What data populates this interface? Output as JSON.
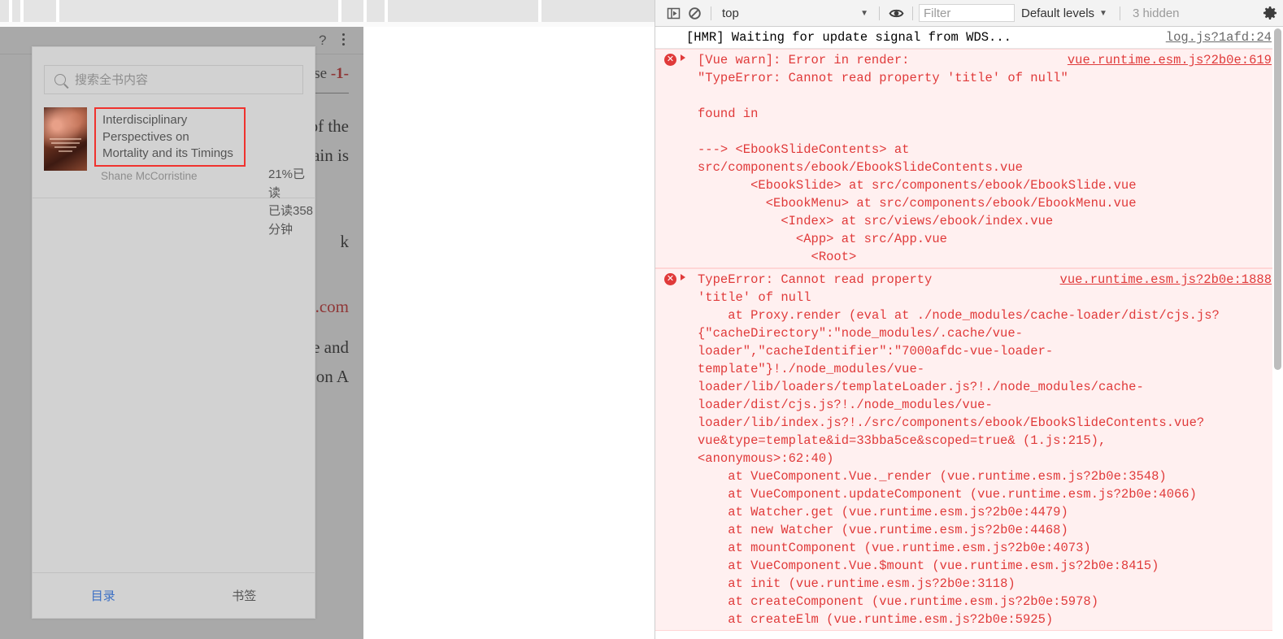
{
  "browser": {
    "skeleton_separators_x": [
      11,
      25,
      69,
      416,
      447,
      473,
      662
    ]
  },
  "reader": {
    "toolbar": {
      "question_icon": "question-mark-icon",
      "menu_icon": "more-vertical-icon"
    },
    "page_text": {
      "running_head": "Corpse",
      "page_number": "-1-",
      "paragraphs": [
        "ed until the morning, when the fall of the curtain is",
        "k",
        "www.example.com",
        "The body was surrounded by of the wake and the sick. upon A"
      ]
    },
    "panel": {
      "search": {
        "placeholder": "搜索全书内容",
        "value": "",
        "icon": "search-icon"
      },
      "book": {
        "title": "Interdisciplinary Perspectives on Mortality and its Timings",
        "author": "Shane McCorristine",
        "progress_percent": "21%已读",
        "progress_time": "已读358分钟",
        "cover_alt": "book-cover"
      },
      "tabs": [
        {
          "label": "目录",
          "active": true
        },
        {
          "label": "书签",
          "active": false
        }
      ]
    }
  },
  "devtools": {
    "toolbar": {
      "sidebar_toggle_icon": "console-sidebar-icon",
      "clear_icon": "clear-console-icon",
      "context": "top",
      "context_caret": "▼",
      "eye_icon": "live-expression-eye-icon",
      "filter_placeholder": "Filter",
      "filter_value": "",
      "levels_label": "Default levels",
      "levels_caret": "▼",
      "hidden_label": "3 hidden",
      "settings_icon": "gear-icon"
    },
    "messages": [
      {
        "type": "info",
        "text": "[HMR] Waiting for update signal from WDS...",
        "source": "log.js?1afd:24"
      },
      {
        "type": "error",
        "expandable": true,
        "text": "[Vue warn]: Error in render:\n\"TypeError: Cannot read property 'title' of null\"\n\nfound in\n\n---> <EbookSlideContents> at\nsrc/components/ebook/EbookSlideContents.vue\n       <EbookSlide> at src/components/ebook/EbookSlide.vue\n         <EbookMenu> at src/components/ebook/EbookMenu.vue\n           <Index> at src/views/ebook/index.vue\n             <App> at src/App.vue\n               <Root>",
        "source": "vue.runtime.esm.js?2b0e:619"
      },
      {
        "type": "error",
        "expandable": true,
        "text": "TypeError: Cannot read property\n'title' of null\n    at Proxy.render (eval at ./node_modules/cache-loader/dist/cjs.js?\n{\"cacheDirectory\":\"node_modules/.cache/vue-\nloader\",\"cacheIdentifier\":\"7000afdc-vue-loader-\ntemplate\"}!./node_modules/vue-\nloader/lib/loaders/templateLoader.js?!./node_modules/cache-\nloader/dist/cjs.js?!./node_modules/vue-\nloader/lib/index.js?!./src/components/ebook/EbookSlideContents.vue?\nvue&type=template&id=33bba5ce&scoped=true& (1.js:215),\n<anonymous>:62:40)\n    at VueComponent.Vue._render (vue.runtime.esm.js?2b0e:3548)\n    at VueComponent.updateComponent (vue.runtime.esm.js?2b0e:4066)\n    at Watcher.get (vue.runtime.esm.js?2b0e:4479)\n    at new Watcher (vue.runtime.esm.js?2b0e:4468)\n    at mountComponent (vue.runtime.esm.js?2b0e:4073)\n    at VueComponent.Vue.$mount (vue.runtime.esm.js?2b0e:8415)\n    at init (vue.runtime.esm.js?2b0e:3118)\n    at createComponent (vue.runtime.esm.js?2b0e:5978)\n    at createElm (vue.runtime.esm.js?2b0e:5925)",
        "source": "vue.runtime.esm.js?2b0e:1888"
      }
    ]
  },
  "colors": {
    "error_red": "#e03a3a",
    "error_bg": "#fff0f0",
    "highlight_box": "#f0322e",
    "tab_active": "#3b6fc4",
    "panel_bg": "#d2d2d2"
  }
}
